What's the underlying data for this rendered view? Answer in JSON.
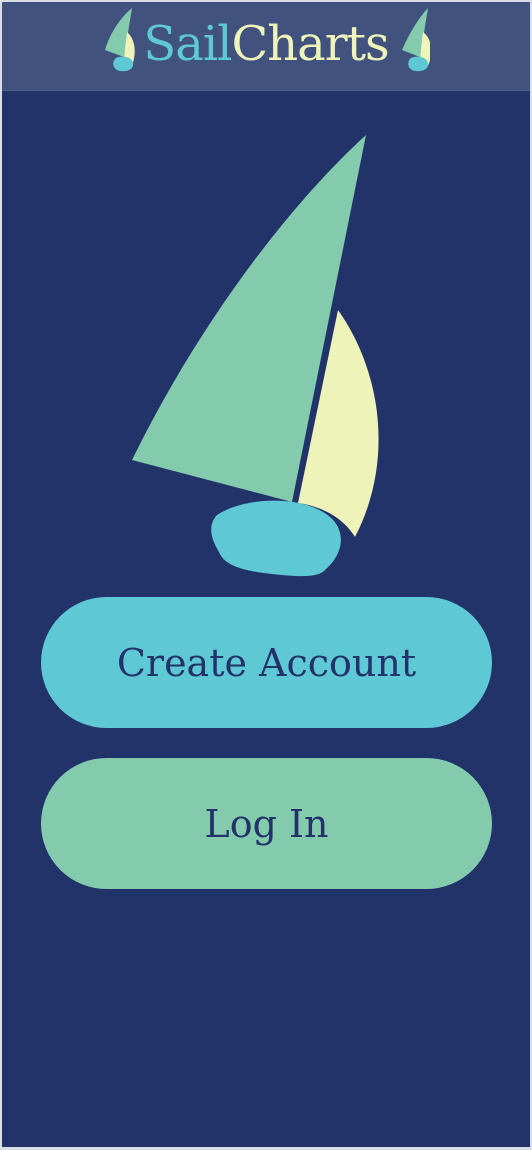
{
  "header": {
    "title_part1": "Sail",
    "title_part2": "Charts"
  },
  "actions": {
    "create_account_label": "Create Account",
    "login_label": "Log In"
  },
  "colors": {
    "background": "#213368",
    "header": "#41527f",
    "accent_teal": "#5fc8d5",
    "accent_green": "#84cbae",
    "accent_cream": "#eef3b9"
  },
  "icons": {
    "header_left": "sailboat-icon",
    "header_right": "sailboat-icon",
    "hero": "sailboat-logo"
  }
}
